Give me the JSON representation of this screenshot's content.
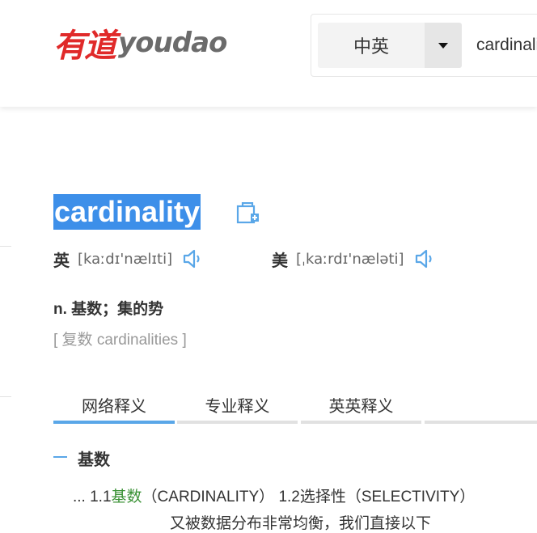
{
  "header": {
    "logo_cn": "有道",
    "logo_en": "youdao",
    "lang_selector": "中英",
    "search_value": "cardinality"
  },
  "entry": {
    "word": "cardinality",
    "pronunciations": [
      {
        "label": "英",
        "phonetic": "[kaːdɪ'nælɪti]"
      },
      {
        "label": "美",
        "phonetic": "[ˌkaːrdɪ'næləti]"
      }
    ],
    "definition": "n. 基数；集的势",
    "plural": "[ 复数 cardinalities ]"
  },
  "tabs": [
    {
      "label": "网络释义",
      "active": true
    },
    {
      "label": "专业释义",
      "active": false
    },
    {
      "label": "英英释义",
      "active": false
    }
  ],
  "web_section": {
    "title": "基数",
    "line_prefix": "... 1.1",
    "highlight": "基数",
    "line_rest": "（CARDINALITY） 1.2选择性（SELECTIVITY）",
    "line2": "又被数据分布非常均衡，我们直接以下"
  },
  "colors": {
    "word_highlight": "#3d8fe9",
    "accent_blue": "#5aa7e8",
    "logo_red": "#e02a2a",
    "match_green": "#3b9236"
  }
}
